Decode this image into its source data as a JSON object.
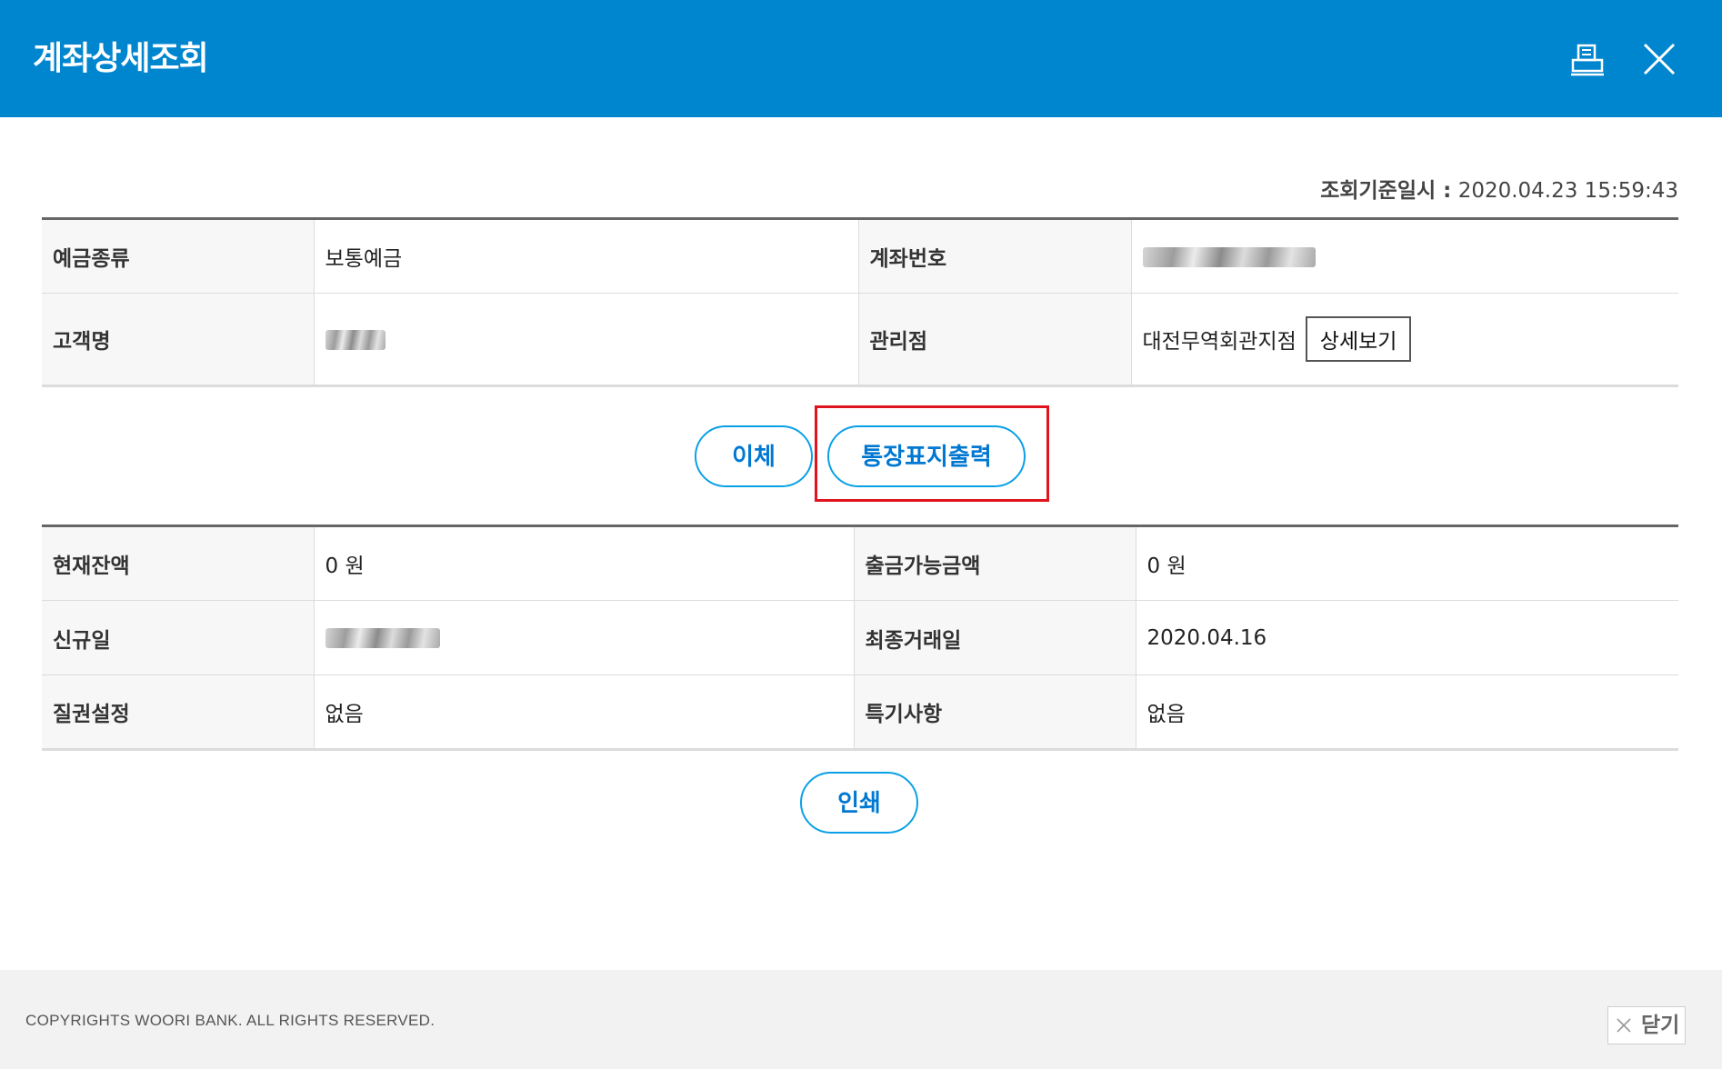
{
  "window": {
    "title": "계좌상세조회",
    "header_color": "#0085cf"
  },
  "inquiry": {
    "label": "조회기준일시 :",
    "value": "2020.04.23 15:59:43"
  },
  "account_info": {
    "deposit_type_label": "예금종류",
    "deposit_type_value": "보통예금",
    "account_number_label": "계좌번호",
    "account_number_value": "",
    "customer_name_label": "고객명",
    "customer_name_value": "",
    "branch_label": "관리점",
    "branch_value": "대전무역회관지점",
    "detail_button": "상세보기"
  },
  "actions": {
    "transfer": "이체",
    "passbook_print": "통장표지출력",
    "highlight_color": "#e0141e"
  },
  "balance_info": {
    "current_balance_label": "현재잔액",
    "current_balance_value": "0 원",
    "available_label": "출금가능금액",
    "available_value": "0 원",
    "opened_label": "신규일",
    "opened_value": "",
    "last_transaction_label": "최종거래일",
    "last_transaction_value": "2020.04.16",
    "pledge_label": "질권설정",
    "pledge_value": "없음",
    "remarks_label": "특기사항",
    "remarks_value": "없음"
  },
  "print_button": "인쇄",
  "footer": {
    "copyright": "COPYRIGHTS WOORI BANK. ALL RIGHTS RESERVED.",
    "close": "닫기"
  },
  "icons": {
    "print": "print-icon",
    "close": "close-icon"
  }
}
